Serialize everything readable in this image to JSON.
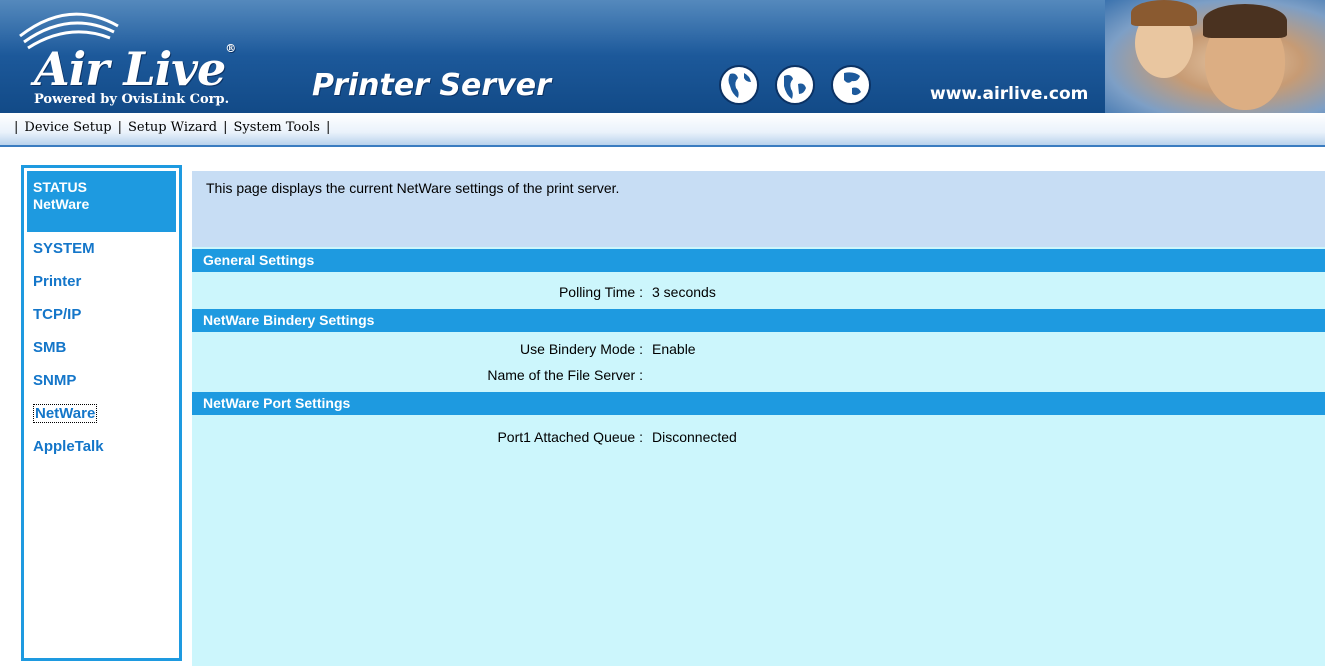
{
  "header": {
    "logo_text": "Air Live",
    "logo_reg": "®",
    "logo_sub": "Powered by OvisLink Corp.",
    "product_title": "Printer Server",
    "site_url": "www.airlive.com",
    "globe_icons": [
      "globe-americas-icon",
      "globe-americas-icon",
      "globe-asia-icon"
    ],
    "colors": {
      "banner": "#1d5a9c",
      "text": "#ffffff"
    }
  },
  "nav": {
    "items": [
      "Device Setup",
      "Setup Wizard",
      "System Tools"
    ],
    "separator": "|"
  },
  "sidebar": {
    "section_title": "STATUS",
    "section_subtitle": "NetWare",
    "items": [
      "SYSTEM",
      "Printer",
      "TCP/IP",
      "SMB",
      "SNMP",
      "NetWare",
      "AppleTalk"
    ],
    "active": "NetWare",
    "accent_color": "#1e9ae0"
  },
  "main": {
    "intro": "This page displays the current NetWare settings of the print server.",
    "sections": [
      {
        "title": "General Settings",
        "rows": [
          {
            "label": "Polling Time :",
            "value": "3 seconds"
          }
        ]
      },
      {
        "title": "NetWare Bindery Settings",
        "rows": [
          {
            "label": "Use Bindery Mode :",
            "value": "Enable"
          },
          {
            "label": "Name of the File Server :",
            "value": ""
          }
        ]
      },
      {
        "title": "NetWare Port Settings",
        "rows": [
          {
            "label": "Port1 Attached Queue :",
            "value": "Disconnected"
          }
        ]
      }
    ],
    "colors": {
      "panel": "#ccf6fc",
      "intro_bg": "#c7ddf4",
      "section_header": "#1e9ae0"
    }
  }
}
